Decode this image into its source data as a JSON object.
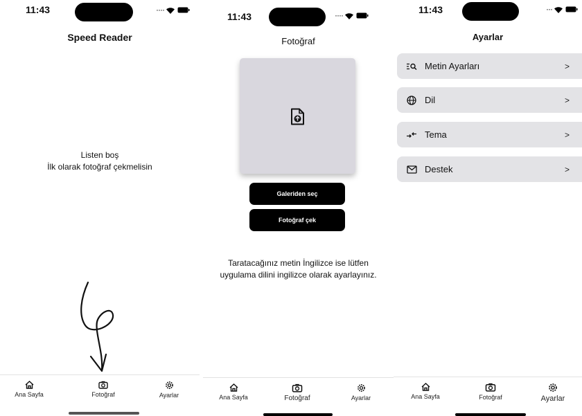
{
  "status": {
    "time": "11:43"
  },
  "home": {
    "title": "Speed Reader",
    "empty_line1": "Listen boş",
    "empty_line2": "İlk olarak fotoğraf çekmelisin"
  },
  "photo": {
    "title": "Fotoğraf",
    "gallery_button": "Galeriden seç",
    "camera_button": "Fotoğraf çek",
    "info_line1": "Taratacağınız metin İngilizce ise lütfen",
    "info_line2": "uygulama dilini ingilizce olarak ayarlayınız."
  },
  "settings": {
    "title": "Ayarlar",
    "items": [
      {
        "label": "Metin Ayarları",
        "icon": "text-search-icon"
      },
      {
        "label": "Dil",
        "icon": "globe-icon"
      },
      {
        "label": "Tema",
        "icon": "swap-arrows-icon"
      },
      {
        "label": "Destek",
        "icon": "mail-icon"
      }
    ],
    "chevron": ">"
  },
  "tabbar": {
    "home": "Ana Sayfa",
    "photo": "Fotoğraf",
    "settings": "Ayarlar"
  }
}
